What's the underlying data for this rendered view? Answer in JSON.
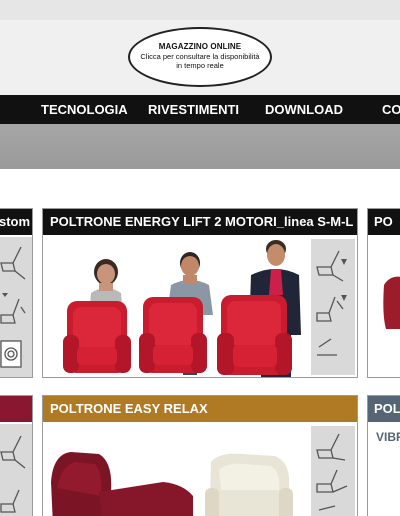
{
  "header": {
    "stock_title": "MAGAZZINO ONLINE",
    "stock_subtitle": "Clicca per consultare la disponibilità in tempo reale"
  },
  "nav": {
    "items": [
      "TECNOLOGIA",
      "RIVESTIMENTI",
      "DOWNLOAD",
      "CO"
    ]
  },
  "cards": {
    "left_partial_title": "stom",
    "energy_lift_title": "POLTRONE ENERGY LIFT 2 MOTORI_linea S-M-L",
    "right_partial_title": "PO",
    "easy_relax_title": "POLTRONE EASY RELAX",
    "right_bottom_title": "POL",
    "right_bottom_subtitle": "VIBRO"
  },
  "colors": {
    "nav_bg": "#111111",
    "title_dark": "#111111",
    "title_gold": "#b07a25",
    "title_slate": "#566574",
    "chair_red": "#d21f33",
    "chair_maroon": "#7d1524",
    "chair_cream": "#ece8d8"
  }
}
